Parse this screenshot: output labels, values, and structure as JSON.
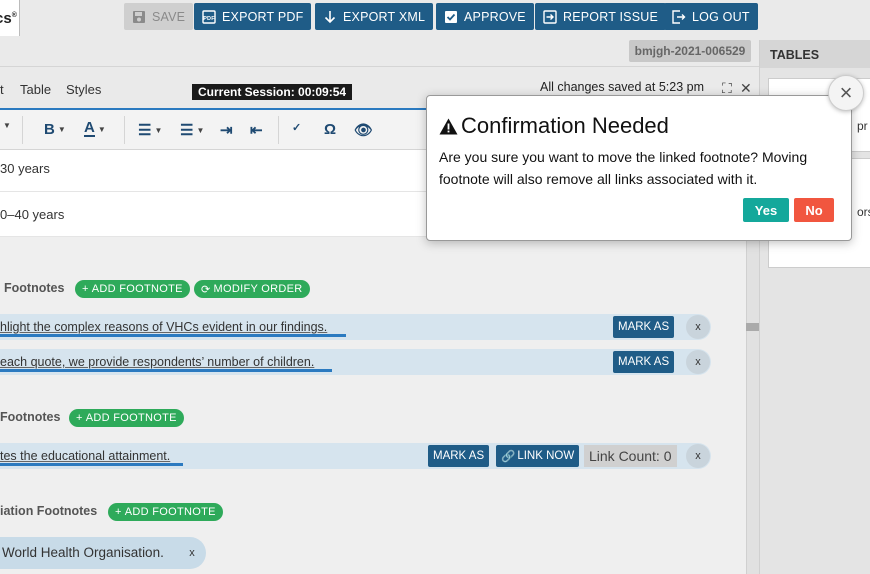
{
  "header": {
    "logo_text": "cs",
    "logo_sup": "®",
    "buttons": {
      "save": "SAVE",
      "export_pdf": "EXPORT PDF",
      "export_xml": "EXPORT XML",
      "approve": "APPROVE",
      "report_issue": "REPORT ISSUE",
      "log_out": "LOG OUT"
    },
    "doc_id": "bmjgh-2021-006529"
  },
  "editor": {
    "menu": {
      "insert_tail": "t",
      "table": "Table",
      "styles": "Styles"
    },
    "session": "Current Session: 00:09:54",
    "saved_status": "All changes saved at 5:23 pm"
  },
  "table_rows": [
    "30 years",
    "0–40 years"
  ],
  "sections": {
    "table_footnotes": {
      "title": "Footnotes",
      "add": "ADD FOOTNOTE",
      "modify": "MODIFY ORDER",
      "items": [
        "hlight the complex reasons of VHCs evident in our findings.",
        "each quote, we provide respondents’ number of children."
      ]
    },
    "other_footnotes": {
      "title": "Footnotes",
      "add": "ADD FOOTNOTE",
      "items": [
        "tes the educational attainment."
      ],
      "link_now": "LINK NOW",
      "link_count": "Link Count: 0"
    },
    "abbreviation_footnotes": {
      "title": "iation Footnotes",
      "add": "ADD FOOTNOTE",
      "items": [
        "World Health Organisation."
      ]
    },
    "mark_as": "MARK AS",
    "remove": "x"
  },
  "tables_panel": {
    "title": "TABLES",
    "card1_text": "pr",
    "card2_text": "ors"
  },
  "modal": {
    "title": "Confirmation Needed",
    "message": "Are you sure you want to move the linked footnote? Moving footnote will also remove all links associated with it.",
    "yes": "Yes",
    "no": "No",
    "close": "×"
  },
  "colors": {
    "primary_button": "#1f5c87",
    "add_button": "#2eaa5a",
    "yes_button": "#14a89b",
    "no_button": "#f1563f"
  }
}
